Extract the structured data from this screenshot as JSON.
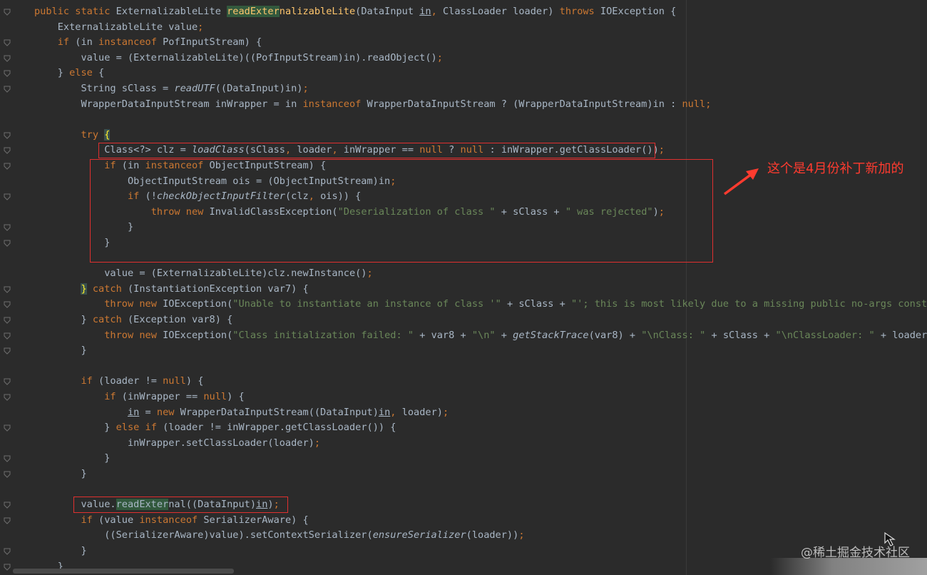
{
  "lines": [
    "public static ExternalizableLite readExternalizableLite(DataInput in, ClassLoader loader) throws IOException {",
    "    ExternalizableLite value;",
    "    if (in instanceof PofInputStream) {",
    "        value = (ExternalizableLite)((PofInputStream)in).readObject();",
    "    } else {",
    "        String sClass = readUTF((DataInput)in);",
    "        WrapperDataInputStream inWrapper = in instanceof WrapperDataInputStream ? (WrapperDataInputStream)in : null;",
    "",
    "        try {",
    "            Class<?> clz = loadClass(sClass, loader, inWrapper == null ? null : inWrapper.getClassLoader());",
    "            if (in instanceof ObjectInputStream) {",
    "                ObjectInputStream ois = (ObjectInputStream)in;",
    "                if (!checkObjectInputFilter(clz, ois)) {",
    "                    throw new InvalidClassException(\"Deserialization of class \" + sClass + \" was rejected\");",
    "                }",
    "            }",
    "",
    "            value = (ExternalizableLite)clz.newInstance();",
    "        } catch (InstantiationException var7) {",
    "            throw new IOException(\"Unable to instantiate an instance of class '\" + sClass + \"'; this is most likely due to a missing public no-args constructor",
    "        } catch (Exception var8) {",
    "            throw new IOException(\"Class initialization failed: \" + var8 + \"\\n\" + getStackTrace(var8) + \"\\nClass: \" + sClass + \"\\nClassLoader: \" + loader + \"\\n",
    "        }",
    "",
    "        if (loader != null) {",
    "            if (inWrapper == null) {",
    "                in = new WrapperDataInputStream((DataInput)in, loader);",
    "            } else if (loader != inWrapper.getClassLoader()) {",
    "                inWrapper.setClassLoader(loader);",
    "            }",
    "        }",
    "",
    "        value.readExternal((DataInput)in);",
    "        if (value instanceof SerializerAware) {",
    "            ((SerializerAware)value).setContextSerializer(ensureSerializer(loader));",
    "        }",
    "    }"
  ],
  "annotation": {
    "text": "这个是4月份补丁新加的"
  },
  "watermark": "@稀土掘金技术社区",
  "colors": {
    "background": "#2b2b2b",
    "text": "#a9b7c6",
    "keyword": "#cc7832",
    "string": "#6a8759",
    "method_decl": "#ffc66d",
    "highlight_box": "#e0302f",
    "annotation": "#ff3b2f"
  }
}
